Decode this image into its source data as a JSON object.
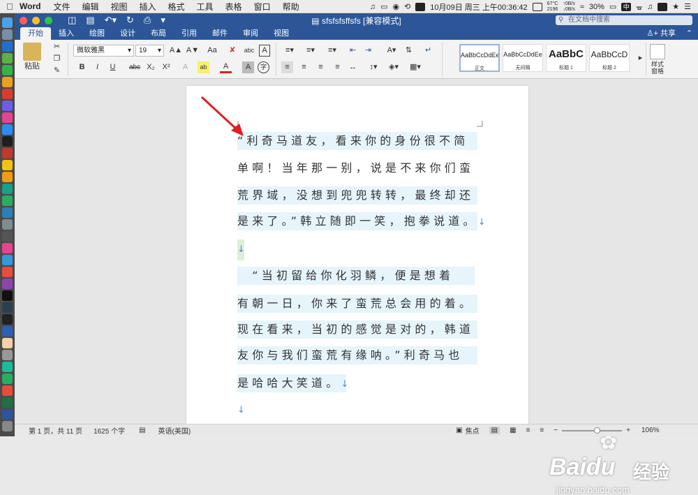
{
  "menubar": {
    "app": "Word",
    "items": [
      "文件",
      "编辑",
      "视图",
      "插入",
      "格式",
      "工具",
      "表格",
      "窗口",
      "帮助"
    ],
    "status": {
      "temp": "67°C",
      "rpm": "2196",
      "net_up": "0B/s",
      "net_down": "0B/s",
      "battery": "30%",
      "input": "中",
      "clock": "10月09日 周三 上午00:36:42"
    }
  },
  "window": {
    "title": "sfsfsfsffsfs [兼容模式]",
    "search_placeholder": "在文档中搜索"
  },
  "tabs": [
    "开始",
    "插入",
    "绘图",
    "设计",
    "布局",
    "引用",
    "邮件",
    "审阅",
    "视图"
  ],
  "share": "共享",
  "ribbon": {
    "paste": "粘贴",
    "font": "微软雅黑",
    "size": "19",
    "bold": "B",
    "italic": "I",
    "underline": "U",
    "strike": "abc",
    "sub": "X₂",
    "sup": "X²",
    "grow": "A▲",
    "shrink": "A▼",
    "case": "Aa",
    "effect": "A",
    "highlight": "ab",
    "color": "A",
    "shade": "A",
    "phonetic": "abc",
    "border_char": "A",
    "enclose": "字",
    "styles": [
      {
        "preview": "AaBbCcDdEe",
        "name": "正文"
      },
      {
        "preview": "AaBbCcDdEe",
        "name": "无间隔"
      },
      {
        "preview": "AaBbC",
        "name": "标题 1"
      },
      {
        "preview": "AaBbCcD",
        "name": "标题 2"
      }
    ],
    "styles_pane": [
      "样式",
      "窗格"
    ]
  },
  "document": {
    "lines": [
      "“利奇马道友，看来你的身份很不简",
      "单啊！当年那一别，说是不来你们蛮",
      "荒界域，没想到兜兜转转，最终却还",
      "是来了。”韩立随即一笑，抱拳说道。",
      "",
      "　“当初留给你化羽鳞，便是想着",
      "有朝一日，你来了蛮荒总会用的着。",
      "现在看来，当初的感觉是对的，韩道",
      "友你与我们蛮荒有缘呐。”利奇马也",
      "是哈哈大笑道。",
      ""
    ],
    "para_mark": "↓"
  },
  "statusbar": {
    "page": "第 1 页，共 11 页",
    "words": "1625 个字",
    "language": "英语(美国)",
    "focus": "焦点",
    "zoom": "106%"
  },
  "watermark": {
    "brand": "Baidu",
    "brand_cn": "经验",
    "url": "jingyan.baidu.com"
  },
  "colors": {
    "title_blue": "#2c5697",
    "highlight": "#e6f4fb",
    "arrow": "#e02020",
    "dock": "#4a4a4a"
  }
}
